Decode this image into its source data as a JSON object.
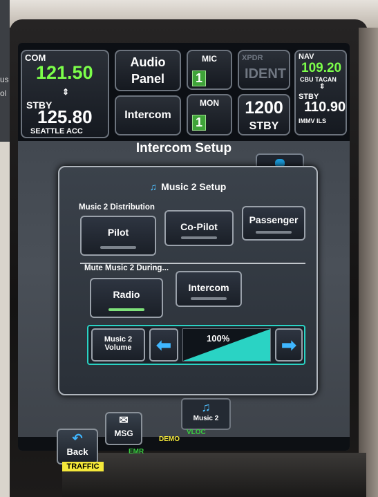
{
  "edge_text": [
    "us",
    "ol"
  ],
  "com": {
    "label": "COM",
    "freq": "121.50",
    "swap": "⇕",
    "stby_label": "STBY",
    "stby_freq": "125.80",
    "stby_name": "SEATTLE ACC"
  },
  "audio_panel": {
    "line1": "Audio",
    "line2": "Panel"
  },
  "intercom": {
    "label": "Intercom"
  },
  "mic": {
    "label": "MIC",
    "value": "1"
  },
  "mon": {
    "label": "MON",
    "value": "1"
  },
  "xpdr": {
    "label": "XPDR",
    "ident": "IDENT",
    "code": "1200",
    "mode": "STBY"
  },
  "nav": {
    "label": "NAV",
    "freq": "109.20",
    "ident": "CBU TACAN",
    "swap": "⇕",
    "stby_label": "STBY",
    "stby_freq": "110.90",
    "stby_ident": "IMMV ILS"
  },
  "page_title": "Intercom Setup",
  "dialog": {
    "title": "Music 2 Setup",
    "title_icon": "music-note-icon",
    "distribution_label": "Music 2 Distribution",
    "distribution": [
      {
        "label": "Pilot",
        "active": false
      },
      {
        "label": "Co-Pilot",
        "active": false
      },
      {
        "label": "Passenger",
        "active": false
      }
    ],
    "mute_label": "Mute Music 2 During...",
    "mute": [
      {
        "label": "Radio",
        "active": true
      },
      {
        "label": "Intercom",
        "active": false
      }
    ],
    "volume_label_1": "Music 2",
    "volume_label_2": "Volume",
    "volume_percent": "100%",
    "volume_level": 1.0
  },
  "music2_button": "Music 2",
  "back": "Back",
  "msg": "MSG",
  "status": {
    "traffic": "TRAFFIC",
    "left": "EMR",
    "demo": "DEMO",
    "right": "VLOC"
  },
  "colors": {
    "accent": "#2ad3c4",
    "active_freq": "#7cff4a",
    "arrow": "#3fb6ff",
    "traffic": "#f4e83a"
  }
}
